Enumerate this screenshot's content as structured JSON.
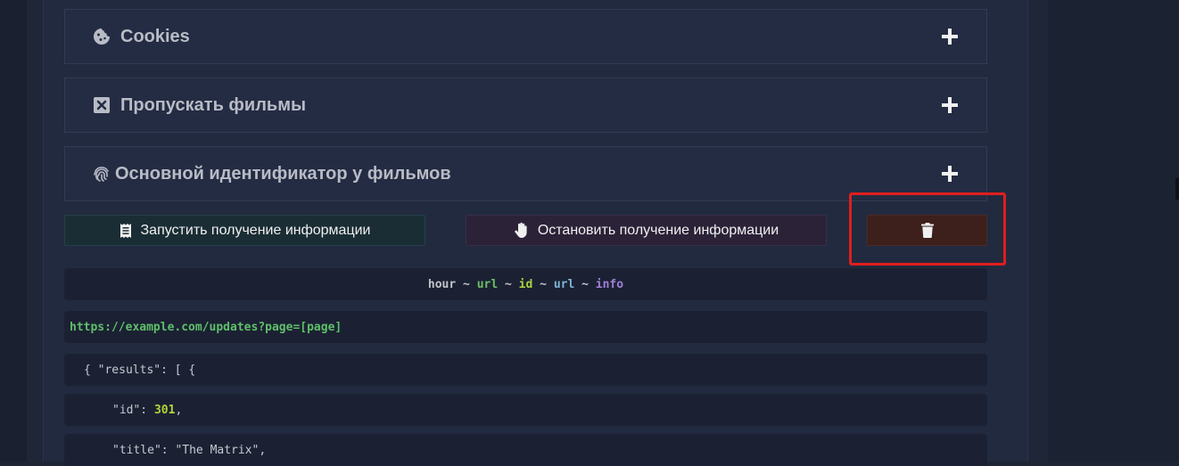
{
  "accordions": [
    {
      "label": "Cookies",
      "icon": "cookie-icon"
    },
    {
      "label": "Пропускать фильмы",
      "icon": "close-square-icon"
    },
    {
      "label": "Основной идентификатор у фильмов",
      "icon": "fingerprint-icon"
    }
  ],
  "buttons": {
    "start_label": "Запустить получение информации",
    "stop_label": "Остановить получение информации",
    "delete_icon": "trash-icon"
  },
  "format": {
    "t1": "hour",
    "sep": " ~ ",
    "t2": "url",
    "t3": "id",
    "t4": "url",
    "t5": "info"
  },
  "url_line": "https://example.com/updates?page=[page]",
  "json_lines": {
    "line1": "{ \"results\": [ {",
    "line2_key": "\"id\": ",
    "line2_val": "301",
    "line2_end": ",",
    "line3": "\"title\": \"The Matrix\","
  },
  "colors": {
    "start_bg": "#1a2d35",
    "stop_bg": "#2b2238",
    "delete_bg": "#3d1f1c",
    "highlight": "#e01e1e"
  }
}
